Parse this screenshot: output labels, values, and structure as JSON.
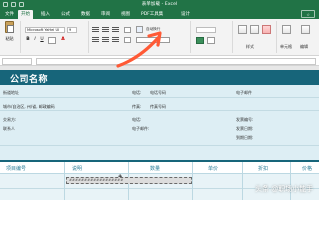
{
  "window": {
    "title": "表单加载 - Excel"
  },
  "ribbon_tabs": [
    {
      "label": "文件",
      "active": false
    },
    {
      "label": "开始",
      "active": true
    },
    {
      "label": "插入",
      "active": false
    },
    {
      "label": "公式",
      "active": false
    },
    {
      "label": "数据",
      "active": false
    },
    {
      "label": "审阅",
      "active": false
    },
    {
      "label": "视图",
      "active": false
    },
    {
      "label": "PDF工具集",
      "active": false
    },
    {
      "label": "设计",
      "active": false
    }
  ],
  "ribbon": {
    "paste_label": "粘贴",
    "font_name": "Microsoft YaHei UI",
    "font_size": "9",
    "wrap_label": "自动换行",
    "styles_label": "样式",
    "cells_label": "单元格",
    "editing_label": "编辑"
  },
  "sheet": {
    "company_name": "公司名称",
    "address_line": "街道地址",
    "city_line": "城市/自治区, 州/省, 邮政编码",
    "phone_label": "电话:",
    "phone_value": "电话号码",
    "fax_label": "传真:",
    "fax_value": "传真号码",
    "email_label": "电子邮件",
    "ship_to_label": "交易方:",
    "contact_name": "联系人",
    "ship_phone": "电话:",
    "ship_email": "电子邮件:",
    "invoice_no_label": "发票编号:",
    "invoice_date_label": "发票日期:",
    "due_date_label": "到期日期:",
    "columns": [
      "项目编号",
      "说明",
      "数量",
      "单价",
      "折扣",
      "价格"
    ],
    "selected_range_text": "##################"
  },
  "watermark": "头条 @职场小能手"
}
